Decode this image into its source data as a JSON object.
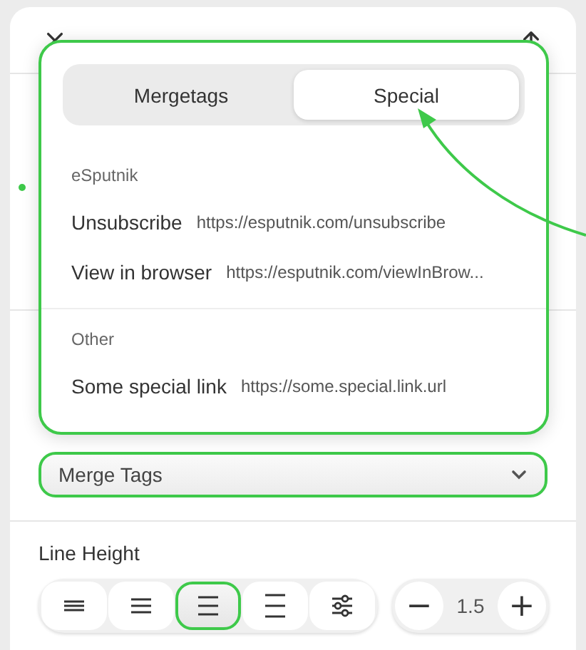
{
  "popup": {
    "highlighted": true,
    "tabs": [
      {
        "label": "Mergetags",
        "selected": false
      },
      {
        "label": "Special",
        "selected": true
      }
    ],
    "groups": [
      {
        "title": "eSputnik",
        "items": [
          {
            "label": "Unsubscribe",
            "url": "https://esputnik.com/unsubscribe"
          },
          {
            "label": "View in browser",
            "url": "https://esputnik.com/viewInBrow..."
          }
        ]
      },
      {
        "title": "Other",
        "items": [
          {
            "label": "Some special link",
            "url": "https://some.special.link.url"
          }
        ]
      }
    ]
  },
  "merge_select": {
    "value": "Merge Tags",
    "highlighted": true
  },
  "line_height": {
    "label": "Line Height",
    "options": [
      {
        "kind": "tight",
        "selected": false
      },
      {
        "kind": "normal",
        "selected": false
      },
      {
        "kind": "relaxed",
        "selected": true
      },
      {
        "kind": "loose",
        "selected": false
      },
      {
        "kind": "custom",
        "selected": false
      }
    ],
    "stepper": {
      "minus": "−",
      "value": "1.5",
      "plus": "+"
    }
  }
}
